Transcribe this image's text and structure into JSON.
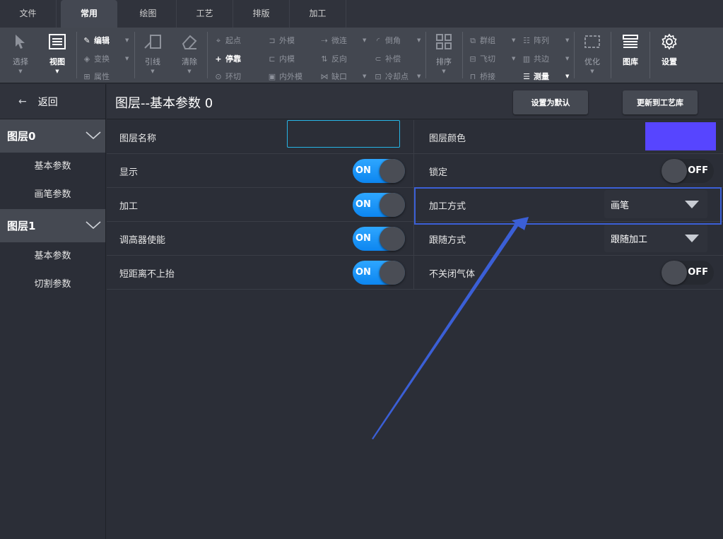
{
  "tabs": [
    {
      "label": "文件"
    },
    {
      "label": "常用"
    },
    {
      "label": "绘图"
    },
    {
      "label": "工艺"
    },
    {
      "label": "排版"
    },
    {
      "label": "加工"
    }
  ],
  "ribbon": {
    "select": "选择",
    "view": "视图",
    "edit": "编辑",
    "transform": "变换",
    "properties": "属性",
    "lead": "引线",
    "clear": "清除",
    "start_point": "起点",
    "dock": "停靠",
    "ring_cut": "环切",
    "outer_mold": "外模",
    "inner_mold": "内模",
    "inner_outer_mold": "内外模",
    "micro_joint": "微连",
    "reverse": "反向",
    "gap": "缺口",
    "chamfer": "倒角",
    "compensate": "补偿",
    "cooling_point": "冷却点",
    "sort": "排序",
    "group": "群组",
    "fly_cut": "飞切",
    "bridge": "桥接",
    "array": "阵列",
    "common_edge": "共边",
    "measure": "测量",
    "optimize": "优化",
    "library": "图库",
    "settings": "设置"
  },
  "sidebar": {
    "back": "返回",
    "layers": [
      {
        "name": "图层0",
        "items": [
          "基本参数",
          "画笔参数"
        ]
      },
      {
        "name": "图层1",
        "items": [
          "基本参数",
          "切割参数"
        ]
      }
    ]
  },
  "header": {
    "title": "图层--基本参数 0",
    "set_default": "设置为默认",
    "update_library": "更新到工艺库"
  },
  "params": {
    "layer_name": "图层名称",
    "layer_color": "图层颜色",
    "layer_color_hex": "#5745ff",
    "show": "显示",
    "lock": "锁定",
    "process": "加工",
    "process_mode": "加工方式",
    "process_mode_value": "画笔",
    "height_enable": "调高器使能",
    "follow_mode": "跟随方式",
    "follow_mode_value": "跟随加工",
    "short_no_lift": "短距离不上抬",
    "no_close_gas": "不关闭气体",
    "on": "ON",
    "off": "OFF"
  },
  "accent_colors": {
    "toggle_on": "#1a94f8",
    "highlight": "#3b5fd6"
  }
}
